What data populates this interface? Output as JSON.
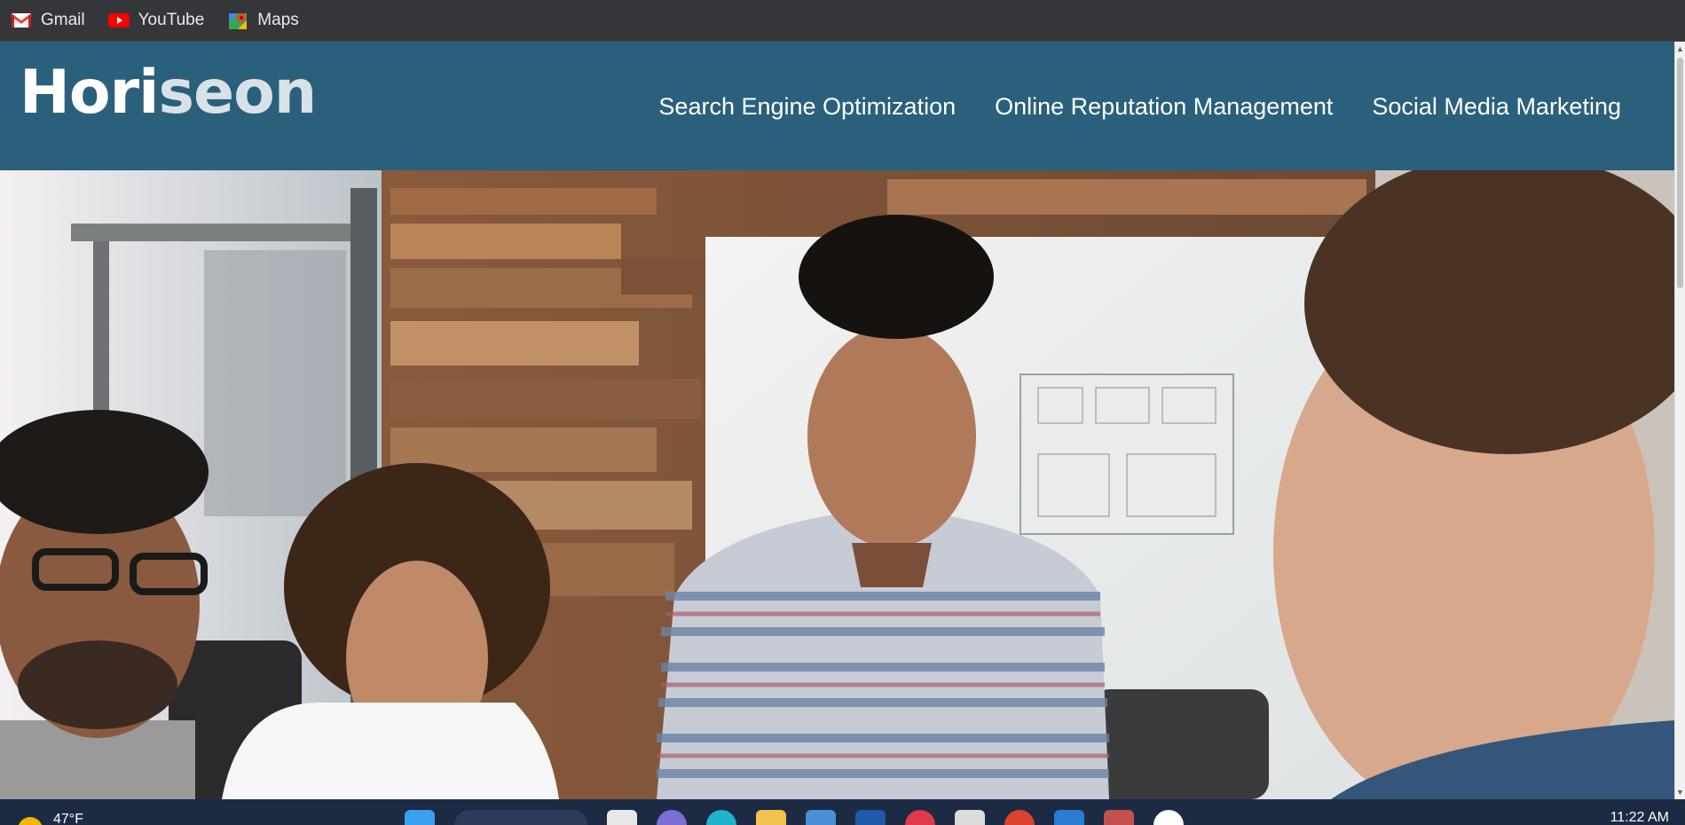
{
  "bookmarks": [
    {
      "label": "Gmail",
      "icon": "gmail-icon"
    },
    {
      "label": "YouTube",
      "icon": "youtube-icon"
    },
    {
      "label": "Maps",
      "icon": "maps-icon"
    }
  ],
  "site": {
    "logo_part1": "Hori",
    "logo_part2": "seon",
    "nav": [
      "Search Engine Optimization",
      "Online Reputation Management",
      "Social Media Marketing"
    ],
    "header_color": "#2a607c"
  },
  "hero": {
    "icon": "team-meeting-photo"
  },
  "taskbar": {
    "temperature": "47°F",
    "time": "11:22 AM"
  }
}
